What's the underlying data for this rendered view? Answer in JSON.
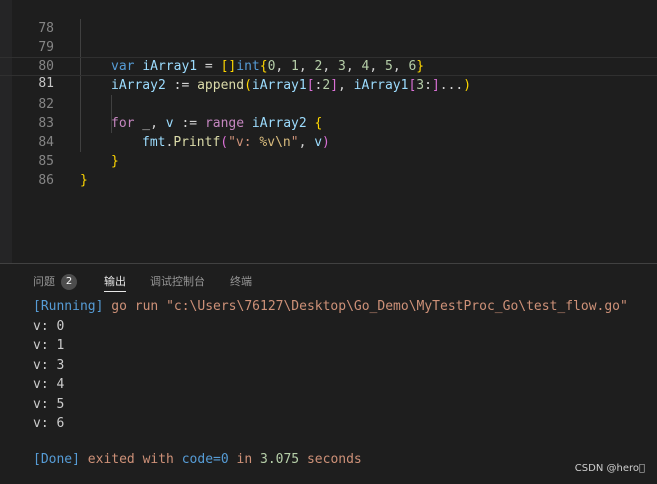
{
  "editor": {
    "lines": [
      {
        "num": "78"
      },
      {
        "num": "79"
      },
      {
        "num": "80"
      },
      {
        "num": "81"
      },
      {
        "num": "82"
      },
      {
        "num": "83"
      },
      {
        "num": "84"
      },
      {
        "num": "85"
      },
      {
        "num": "86"
      }
    ],
    "code": {
      "l79_var": "var",
      "l79_name": "iArray1",
      "l79_assign": " = ",
      "l79_open": "[]",
      "l79_type": "int",
      "l79_brace_open": "{",
      "l79_n0": "0",
      "l79_n1": "1",
      "l79_n2": "2",
      "l79_n3": "3",
      "l79_n4": "4",
      "l79_n5": "5",
      "l79_n6": "6",
      "l79_brace_close": "}",
      "l80_name": "iArray2",
      "l80_assign": " := ",
      "l80_fn": "append",
      "l80_paren_open": "(",
      "l80_arg1": "iArray1",
      "l80_slice1_open": "[",
      "l80_slice1_body": ":",
      "l80_num2": "2",
      "l80_slice1_close": "]",
      "l80_comma": ", ",
      "l80_arg2": "iArray1",
      "l80_slice2_open": "[",
      "l80_num3": "3",
      "l80_slice2_body": ":",
      "l80_slice2_close": "]",
      "l80_ellipsis": "...",
      "l80_paren_close": ")",
      "l82_for": "for",
      "l82_blank": " _, ",
      "l82_v": "v",
      "l82_assign": " := ",
      "l82_range": "range",
      "l82_space": " ",
      "l82_iter": "iArray2",
      "l82_brace": "{",
      "l83_pkg": "fmt",
      "l83_dot": ".",
      "l83_fn": "Printf",
      "l83_paren_open": "(",
      "l83_str1": "\"v: ",
      "l83_fmt": "%v\\n",
      "l83_str2": "\"",
      "l83_comma": ", ",
      "l83_v": "v",
      "l83_paren_close": ")",
      "l84_brace": "}",
      "l85_brace": "}"
    }
  },
  "panel": {
    "tabs": [
      {
        "label": "问题",
        "badge": "2"
      },
      {
        "label": "输出"
      },
      {
        "label": "调试控制台"
      },
      {
        "label": "终端"
      }
    ],
    "output": {
      "running_tag": "[Running]",
      "running_cmd": " go run \"c:\\Users\\76127\\Desktop\\Go_Demo\\MyTestProc_Go\\test_flow.go\"",
      "lines": [
        "v: 0",
        "v: 1",
        "v: 3",
        "v: 4",
        "v: 5",
        "v: 6"
      ],
      "done_tag": "[Done]",
      "done_text1": " exited with ",
      "done_code": "code=0",
      "done_text2": " in ",
      "done_time": "3.075",
      "done_text3": " seconds"
    }
  },
  "watermark": "CSDN @hero\u0000"
}
